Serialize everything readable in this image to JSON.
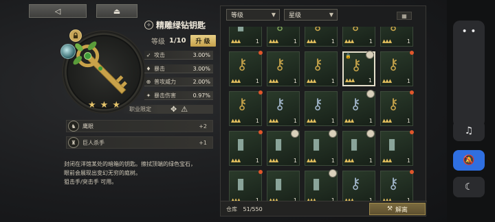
{
  "nav": {
    "back_icon": "back-triangle-icon",
    "back_glyph": "◁",
    "eject_icon": "eject-icon",
    "eject_glyph": "⏏"
  },
  "item": {
    "name": "精雕绿钻钥匙",
    "level_label": "等级",
    "level_value": "1/10",
    "upgrade_label": "升 级",
    "stars": [
      "★",
      "★",
      "★"
    ],
    "stats": [
      {
        "icon": "➶",
        "name": "攻击",
        "value": "3.00%"
      },
      {
        "icon": "♦",
        "name": "暴击",
        "value": "3.00%"
      },
      {
        "icon": "⊕",
        "name": "普攻威力",
        "value": "2.00%"
      },
      {
        "icon": "✦",
        "name": "暴击伤害",
        "value": "0.97%"
      }
    ],
    "class_limit_label": "职业限定",
    "class_icons": [
      "✥",
      "⚠"
    ]
  },
  "skills": [
    {
      "icon": "♞",
      "name": "鹰眼",
      "value": "+2"
    },
    {
      "icon": "♜",
      "name": "巨人杀手",
      "value": "+1"
    }
  ],
  "description": [
    "封闭在洋馆某处的暗箱的钥匙。擦拭顶端的绿色宝石，",
    "眼前会展现出变幻无穷的庭树。",
    "狙击手/突击手 可用。"
  ],
  "inventory": {
    "filter_level": "等级",
    "filter_star": "星级",
    "storage_label": "仓库",
    "storage_count": "51/550",
    "decompose_label": "解离",
    "slot_number": "1"
  },
  "system": {
    "more_glyph": "• •",
    "music_glyph": "♫",
    "bell_glyph": "🔕",
    "moon_glyph": "☾"
  }
}
